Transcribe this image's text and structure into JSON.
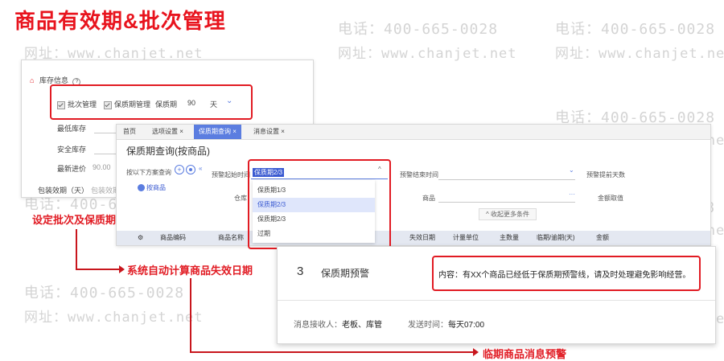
{
  "title": "商品有效期&批次管理",
  "watermark": {
    "phone": "电话：400-665-0028",
    "site": "网址：www.chanjet.net"
  },
  "inventory_panel": {
    "header": "库存信息",
    "batch_label": "批次管理",
    "shelf_label": "保质期管理",
    "period_label": "保质期",
    "period_value": "90",
    "period_unit": "天",
    "min_stock": "最低库存",
    "safe_stock": "安全库存",
    "last_price": "最新进价",
    "last_price_value": "90.00",
    "expiry_label": "包装效期（天）",
    "expiry_placeholder": "包装效期"
  },
  "query_panel": {
    "tabs": [
      {
        "label": "首页"
      },
      {
        "label": "选项设置"
      },
      {
        "label": "保质期查询"
      },
      {
        "label": "消息设置"
      }
    ],
    "title": "保质期查询(按商品)",
    "scheme_label": "按以下方案查询",
    "scheme_button": "按商品",
    "warn_start": "预警起始时间",
    "warn_end": "预警结束时间",
    "warn_days": "预警提前天数",
    "dropdown_value": "保质期2/3",
    "dropdown_options": [
      "保质期1/3",
      "保质期2/3",
      "保质期2/3",
      "过期"
    ],
    "warehouse": "仓库",
    "product": "商品",
    "amount": "金额取值",
    "collapse": "收起更多条件",
    "table_headers": [
      "商品编码",
      "商品名称",
      "失效日期",
      "计量单位",
      "主数量",
      "临期/逾期(天)",
      "金额"
    ]
  },
  "message_panel": {
    "number": "3",
    "title": "保质期预警",
    "content": "内容：有XX个商品已经低于保质期预警线，请及时处理避免影响经营。",
    "receivers_label": "消息接收人：",
    "receivers": "老板、库管",
    "send_time_label": "发送时间：",
    "send_time": "每天07:00"
  },
  "annotations": {
    "set_batch": "设定批次及保质期",
    "auto_calc": "系统自动计算商品失效日期",
    "expiry_alert": "临期商品消息预警"
  },
  "colors": {
    "accent_red": "#e11b23",
    "tab_blue": "#5b7de0",
    "link_blue": "#3a5ad1"
  }
}
